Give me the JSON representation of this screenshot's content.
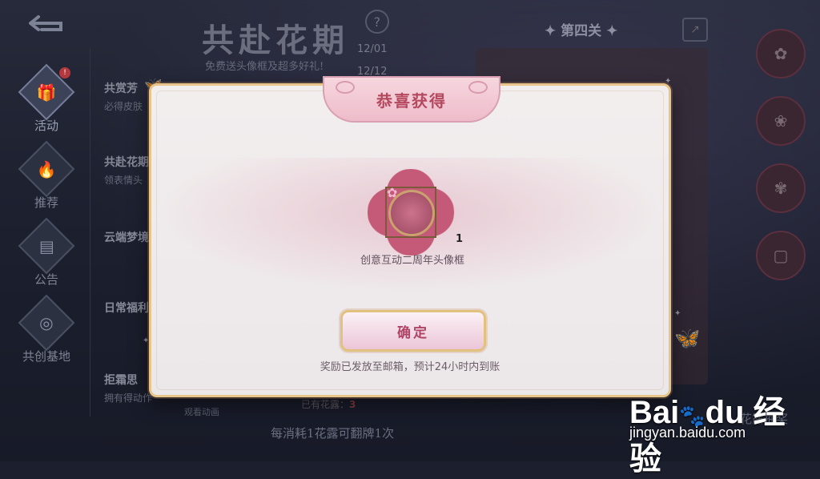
{
  "background": {
    "event_title": "共赴花期",
    "event_subtitle": "免费送头像框及超多好礼!",
    "dates": [
      "12/01",
      "12/12"
    ],
    "help_symbol": "?",
    "stage_title": "第四关",
    "share_symbol": "↗",
    "nav": [
      {
        "label": "活动",
        "icon": "gift-icon",
        "glyph": "🎁",
        "badge": "!"
      },
      {
        "label": "推荐",
        "icon": "flame-icon",
        "glyph": "🔥"
      },
      {
        "label": "公告",
        "icon": "notice-icon",
        "glyph": "▤"
      },
      {
        "label": "共创基地",
        "icon": "base-icon",
        "glyph": "◎"
      }
    ],
    "sub_items": [
      {
        "title": "共赏芳",
        "desc": "必得皮肤"
      },
      {
        "title": "共赴花期",
        "desc": "领表情头"
      },
      {
        "title": "云端梦境",
        "desc": ""
      },
      {
        "title": "日常福利",
        "desc": ""
      },
      {
        "title": "拒霜思",
        "desc": "拥有得动作"
      }
    ],
    "watch_animation": "观看动画",
    "have_flowers_label": "已有花露：",
    "have_flowers_value": "3",
    "bottom_hint": "每消耗1花露可翻牌1次",
    "bottom_right": "花露抽奖"
  },
  "dialog": {
    "title": "恭喜获得",
    "reward": {
      "name": "创意互动二周年头像框",
      "count": "1",
      "icon": "avatar-frame-icon"
    },
    "confirm_label": "确定",
    "notice": "奖励已发放至邮箱，预计24小时内到账"
  },
  "watermark": {
    "logo": "Bai du 经验",
    "url": "jingyan.baidu.com"
  },
  "colors": {
    "accent_pink": "#b4485e",
    "gold_border": "#e6c68a",
    "dialog_bg": "#f2eeee"
  }
}
